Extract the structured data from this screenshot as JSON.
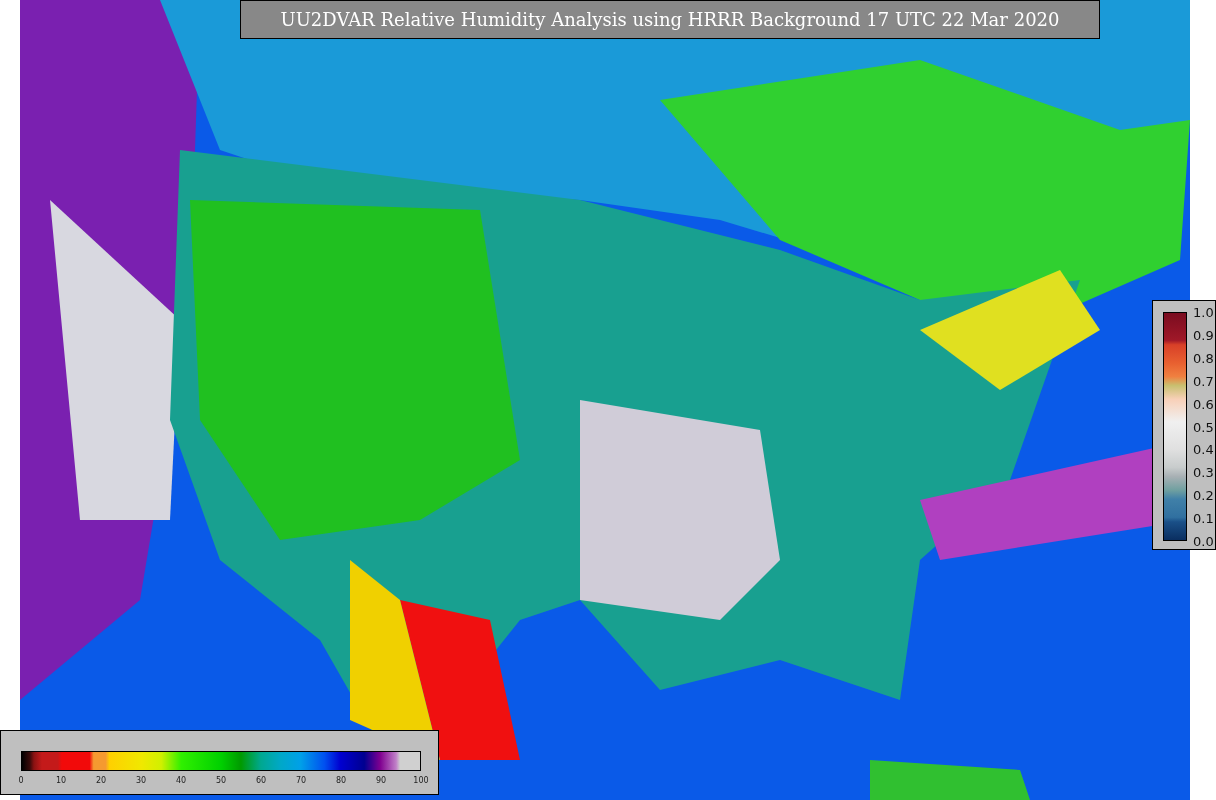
{
  "title": "UU2DVAR Relative Humidity Analysis using HRRR Background 17 UTC 22 Mar 2020",
  "humidity_colorbar": {
    "ticks": [
      "0",
      "10",
      "20",
      "30",
      "40",
      "50",
      "60",
      "70",
      "80",
      "90",
      "100"
    ]
  },
  "ratio_colorbar": {
    "ticks": [
      "1.0",
      "0.9",
      "0.8",
      "0.7",
      "0.6",
      "0.5",
      "0.4",
      "0.3",
      "0.2",
      "0.1",
      "0.0"
    ]
  }
}
